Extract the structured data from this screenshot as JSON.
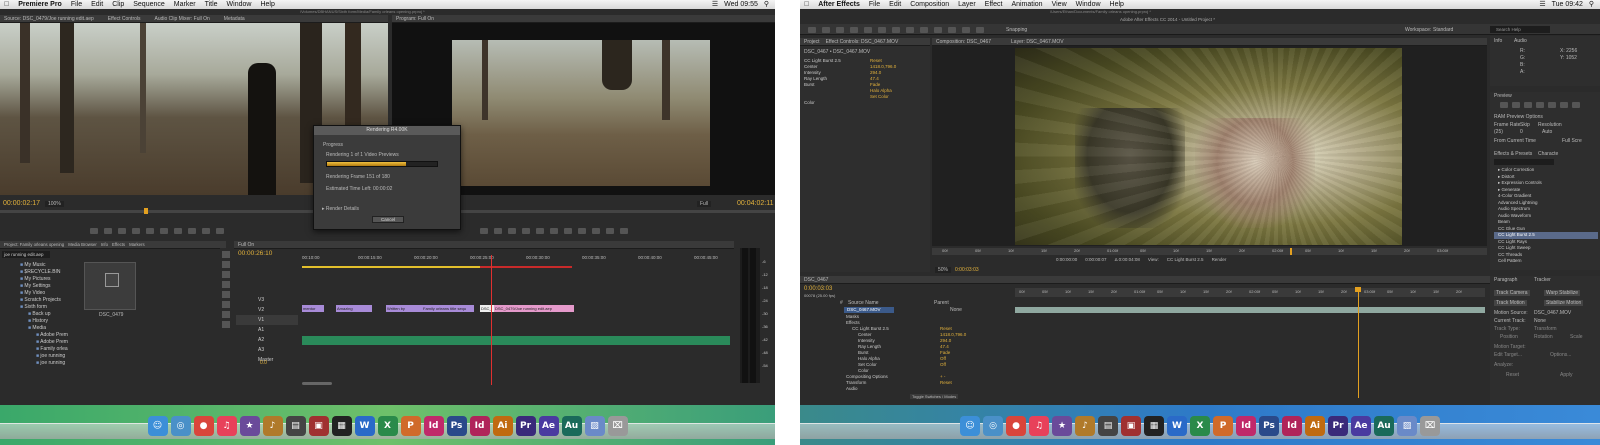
{
  "left": {
    "menubar": {
      "app": "Premiere Pro",
      "items": [
        "File",
        "Edit",
        "Clip",
        "Sequence",
        "Marker",
        "Title",
        "Window",
        "Help"
      ],
      "clock": "Wed 09:55"
    },
    "window_title": "/Volumes/DBHANUS/Sixth form/Media/Family orleans opening.prproj *",
    "source_tabs": [
      "Source: DSC_0479/Joe running edit.aep",
      "Effect Controls",
      "Audio Clip Mixer: Full On",
      "Metadata"
    ],
    "program_tab": "Program: Full On",
    "source_timecode": "00:00:02:17",
    "source_zoom": "100%",
    "program_timecode": "00:04:02:11",
    "program_zoom": "Full",
    "render_dialog": {
      "title": "Rendering  R4.00K",
      "section": "Progress",
      "line1": "Rendering 1 of 1 Video Previews",
      "progress": 0.72,
      "line2": "Rendering Frame 151 of 180",
      "line3": "Estimated Time Left: 00:00:02",
      "details": "Render Details",
      "cancel": "Cancel"
    },
    "project_tabs": [
      "Project: Family orleans opening",
      "Media Browser",
      "Info",
      "Effects",
      "Markers"
    ],
    "search_value": "joe running edit.aep",
    "tree": [
      "My Music",
      "$RECYCLE.BIN",
      "My Pictures",
      "My Settings",
      "My Video",
      "Scratch Projects",
      "Sixth form",
      "Back up",
      "History",
      "Media",
      "Adobe Prem",
      "Adobe Prem",
      "Family orlea",
      "joe running",
      "joe running"
    ],
    "thumb_label": "DSC_0479",
    "sequence_tab": "Full On",
    "sequence_timecode": "00:00:26:10",
    "ruler": [
      "00:10:00",
      "00:00:15:00",
      "00:00:20:00",
      "00:00:25:00",
      "00:00:30:00",
      "00:00:35:00",
      "00:00:40:00",
      "00:00:45:00"
    ],
    "tracks": [
      "V3",
      "V2",
      "V1",
      "A1",
      "A2",
      "A3",
      "Master"
    ],
    "master_value": "0.0",
    "clips": [
      "mentor",
      "Amazing",
      "Written by",
      "Family orleans title sequ",
      "DSC_",
      "DSC_0479/Joe running edit.aep"
    ],
    "meter_labels": [
      "-6",
      "-12",
      "-18",
      "-24",
      "-30",
      "-36",
      "-42",
      "-48",
      "-54"
    ]
  },
  "right": {
    "menubar": {
      "app": "After Effects",
      "items": [
        "File",
        "Edit",
        "Composition",
        "Layer",
        "Effect",
        "Animation",
        "View",
        "Window",
        "Help"
      ],
      "clock": "Tue 09:42"
    },
    "window_title": "Adobe After Effects CC 2014 - Untitled Project *",
    "path": "/Users/Ethan/Documents/Family orleans opening.prproj *",
    "toolbar": {
      "snapping": "Snapping",
      "workspace_label": "Workspace:",
      "workspace_value": "Standard",
      "search": "Search Help"
    },
    "project_tabs": [
      "Project",
      "Effect Controls: DSC_0467.MOV"
    ],
    "effect_header": "DSC_0467 • DSC_0467.MOV",
    "effect_rows": [
      {
        "label": "CC Light Burst 2.5",
        "value": "Reset"
      },
      {
        "label": "Center",
        "value": "1418.0,796.0"
      },
      {
        "label": "Intensity",
        "value": "294.0"
      },
      {
        "label": "Ray Length",
        "value": "47.4"
      },
      {
        "label": "Burst",
        "value": "Fade"
      },
      {
        "label": "",
        "value": "Halo Alpha"
      },
      {
        "label": "",
        "value": "Set Color"
      },
      {
        "label": "Color",
        "value": ""
      }
    ],
    "comp_tabs": [
      "Composition: DSC_0467",
      "Layer: DSC_0467.MOV"
    ],
    "view_time": [
      "0:00:00:00",
      "0:00:00:07",
      "Δ 0:00:04:08",
      "View:",
      "CC Light Burst 2.5",
      "Render"
    ],
    "comp_ruler": [
      "00f",
      "05f",
      "10f",
      "15f",
      "20f",
      "01:00f",
      "05f",
      "10f",
      "15f",
      "20f",
      "02:00f",
      "05f",
      "10f",
      "15f",
      "20f",
      "03:00f"
    ],
    "comp_zoom": "50%",
    "comp_time": "0:00:03:03",
    "info_labels": [
      "Info",
      "Audio",
      "R:",
      "G:",
      "B:",
      "A:",
      "X: 2256",
      "Y: 1052"
    ],
    "preview": {
      "title": "Preview",
      "ram": "RAM Preview Options",
      "frame_rate": "Frame Rate",
      "skip": "Skip",
      "resolution": "Resolution",
      "fps": "(25)",
      "skip_val": "0",
      "res_val": "Auto",
      "from_current": "From Current Time",
      "full_screen": "Full Scre"
    },
    "effects_tabs": [
      "Effects & Presets",
      "Characte"
    ],
    "effects_list": [
      "Color Correction",
      "Distort",
      "Expression Controls",
      "Generate",
      "4-Color Gradient",
      "Advanced Lightning",
      "Audio Spectrum",
      "Audio Waveform",
      "Beam",
      "CC Glue Gun",
      "CC Light Burst 2.5",
      "CC Light Rays",
      "CC Light Sweep",
      "CC Threads",
      "Cell Pattern"
    ],
    "timeline_tab": "DSC_0467",
    "timeline_timecode": "0:00:03:03",
    "timeline_fps": "00078 (25.00 fps)",
    "layer_cols": [
      "#",
      "Source Name",
      "Parent"
    ],
    "layer_name": "DSC_0467.MOV",
    "layer_parent": "None",
    "layer_rows": [
      {
        "label": "Masks",
        "value": ""
      },
      {
        "label": "Effects",
        "value": ""
      },
      {
        "label": "CC Light Burst 2.5",
        "value": "Reset"
      },
      {
        "label": "Center",
        "value": "1418.0,796.0"
      },
      {
        "label": "Intensity",
        "value": "294.0"
      },
      {
        "label": "Ray Length",
        "value": "47.4"
      },
      {
        "label": "Burst",
        "value": "Fade"
      },
      {
        "label": "Halo Alpha",
        "value": "Off"
      },
      {
        "label": "Set Color",
        "value": "Off"
      },
      {
        "label": "Color",
        "value": ""
      },
      {
        "label": "Compositing Options",
        "value": "+ -"
      },
      {
        "label": "Transform",
        "value": "Reset"
      },
      {
        "label": "Audio",
        "value": ""
      }
    ],
    "tl_ruler": [
      "00f",
      "05f",
      "10f",
      "15f",
      "20f",
      "01:00f",
      "05f",
      "10f",
      "15f",
      "20f",
      "02:00f",
      "05f",
      "10f",
      "15f",
      "20f",
      "03:00f",
      "05f",
      "10f",
      "15f",
      "20f"
    ],
    "toggle_label": "Toggle Switches / Modes",
    "tracker": {
      "tabs": [
        "Paragraph",
        "Tracker"
      ],
      "track_camera": "Track Camera",
      "warp_stabilizer": "Warp Stabilize",
      "track_motion": "Track Motion",
      "stabilize_motion": "Stabilize Motion",
      "motion_source_label": "Motion Source:",
      "motion_source": "DSC_0467.MOV",
      "current_track_label": "Current Track:",
      "current_track": "None",
      "track_type_label": "Track Type:",
      "track_type": "Transform",
      "position": "Position",
      "rotation": "Rotation",
      "scale": "Scale",
      "motion_target": "Motion Target:",
      "edit_target": "Edit Target...",
      "options": "Options...",
      "analyze": "Analyze:",
      "reset": "Reset",
      "apply": "Apply"
    }
  },
  "dock_icons": [
    {
      "name": "finder",
      "glyph": "☺",
      "color": "#3c8fd8"
    },
    {
      "name": "safari",
      "glyph": "◎",
      "color": "#4a90c8"
    },
    {
      "name": "chrome",
      "glyph": "●",
      "color": "#d9453b"
    },
    {
      "name": "itunes",
      "glyph": "♫",
      "color": "#e8415a"
    },
    {
      "name": "imovie",
      "glyph": "★",
      "color": "#6a4a9a"
    },
    {
      "name": "guitar",
      "glyph": "♪",
      "color": "#b07a2a"
    },
    {
      "name": "clapper",
      "glyph": "▤",
      "color": "#444"
    },
    {
      "name": "photobooth",
      "glyph": "▣",
      "color": "#a03030"
    },
    {
      "name": "finalcut",
      "glyph": "▦",
      "color": "#222"
    },
    {
      "name": "word",
      "glyph": "W",
      "color": "#2a6ac8"
    },
    {
      "name": "excel",
      "glyph": "X",
      "color": "#2a8a4a"
    },
    {
      "name": "powerpoint",
      "glyph": "P",
      "color": "#d06a2a"
    },
    {
      "name": "indesign",
      "glyph": "Id",
      "color": "#c0296a"
    },
    {
      "name": "photoshop",
      "glyph": "Ps",
      "color": "#2a4a8a"
    },
    {
      "name": "indesign2",
      "glyph": "Id",
      "color": "#b0245a"
    },
    {
      "name": "illustrator",
      "glyph": "Ai",
      "color": "#c06a10"
    },
    {
      "name": "premiere",
      "glyph": "Pr",
      "color": "#3a2a7a"
    },
    {
      "name": "aftereffects",
      "glyph": "Ae",
      "color": "#4a3aa0"
    },
    {
      "name": "audition",
      "glyph": "Au",
      "color": "#1a6a5a"
    },
    {
      "name": "stack",
      "glyph": "▨",
      "color": "#6a8ac8"
    },
    {
      "name": "trash",
      "glyph": "⌧",
      "color": "#999"
    }
  ]
}
